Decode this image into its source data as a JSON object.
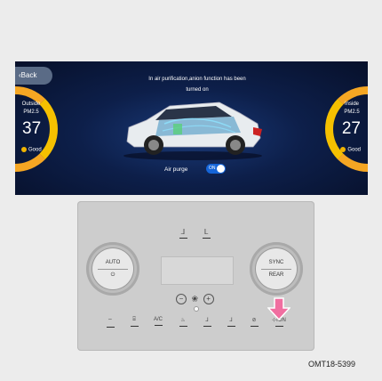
{
  "screen": {
    "back_label": "Back",
    "message_line1": "In air purification,anion function has been",
    "message_line2": "turned on",
    "outside": {
      "title_line1": "Outside",
      "title_line2": "PM2.5",
      "value": "37",
      "status": "Good"
    },
    "inside": {
      "title_line1": "Inside",
      "title_line2": "PM2.5",
      "value": "27",
      "status": "Good"
    },
    "purge_label": "Air purge",
    "purge_toggle": "ON"
  },
  "panel": {
    "left_knob": {
      "top": "AUTO",
      "bottom": "⏻"
    },
    "right_knob": {
      "top": "SYNC",
      "bottom": "REAR"
    },
    "fan_minus": "−",
    "fan_icon": "❀",
    "fan_plus": "+",
    "buttons": [
      "⌔",
      "⌸",
      "A/C",
      "♨",
      "⅃",
      "⅃",
      "⊘",
      "⊹ION"
    ]
  },
  "caption": "OMT18-5399",
  "colors": {
    "gauge_orange": "#f5a623",
    "gauge_yellow": "#f5c000",
    "toggle_blue": "#1565d8",
    "arrow_pink": "#f06ea0"
  }
}
